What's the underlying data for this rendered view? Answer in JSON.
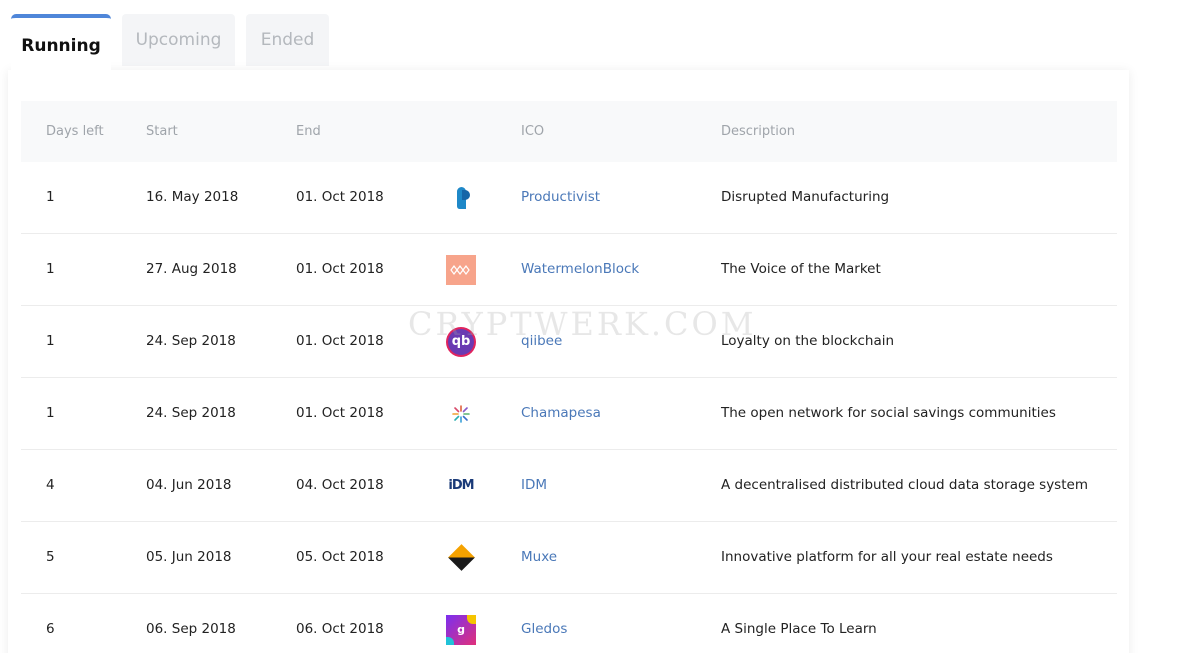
{
  "tabs": [
    {
      "label": "Running",
      "active": true
    },
    {
      "label": "Upcoming",
      "active": false
    },
    {
      "label": "Ended",
      "active": false
    }
  ],
  "table": {
    "headers": {
      "days_left": "Days left",
      "start": "Start",
      "end": "End",
      "ico": "ICO",
      "description": "Description"
    },
    "rows": [
      {
        "days_left": "1",
        "start": "16. May 2018",
        "end": "01. Oct 2018",
        "logo": "productivist-logo",
        "ico": "Productivist",
        "description": "Disrupted Manufacturing"
      },
      {
        "days_left": "1",
        "start": "27. Aug 2018",
        "end": "01. Oct 2018",
        "logo": "watermelonblock-logo",
        "ico": "WatermelonBlock",
        "description": "The Voice of the Market"
      },
      {
        "days_left": "1",
        "start": "24. Sep 2018",
        "end": "01. Oct 2018",
        "logo": "qiibee-logo",
        "ico": "qiibee",
        "description": "Loyalty on the blockchain"
      },
      {
        "days_left": "1",
        "start": "24. Sep 2018",
        "end": "01. Oct 2018",
        "logo": "chamapesa-logo",
        "ico": "Chamapesa",
        "description": "The open network for social savings communities"
      },
      {
        "days_left": "4",
        "start": "04. Jun 2018",
        "end": "04. Oct 2018",
        "logo": "idm-logo",
        "ico": "IDM",
        "description": "A decentralised distributed cloud data storage system"
      },
      {
        "days_left": "5",
        "start": "05. Jun 2018",
        "end": "05. Oct 2018",
        "logo": "muxe-logo",
        "ico": "Muxe",
        "description": "Innovative platform for all your real estate needs"
      },
      {
        "days_left": "6",
        "start": "06. Sep 2018",
        "end": "06. Oct 2018",
        "logo": "gledos-logo",
        "ico": "Gledos",
        "description": "A Single Place To Learn"
      }
    ]
  },
  "logo_text": {
    "qiibee": "qb",
    "idm": "iDM",
    "gledos": "g"
  },
  "watermark": "CRYPTWERK.COM",
  "colors": {
    "accent": "#4f86d9",
    "link": "#4a78b8"
  }
}
